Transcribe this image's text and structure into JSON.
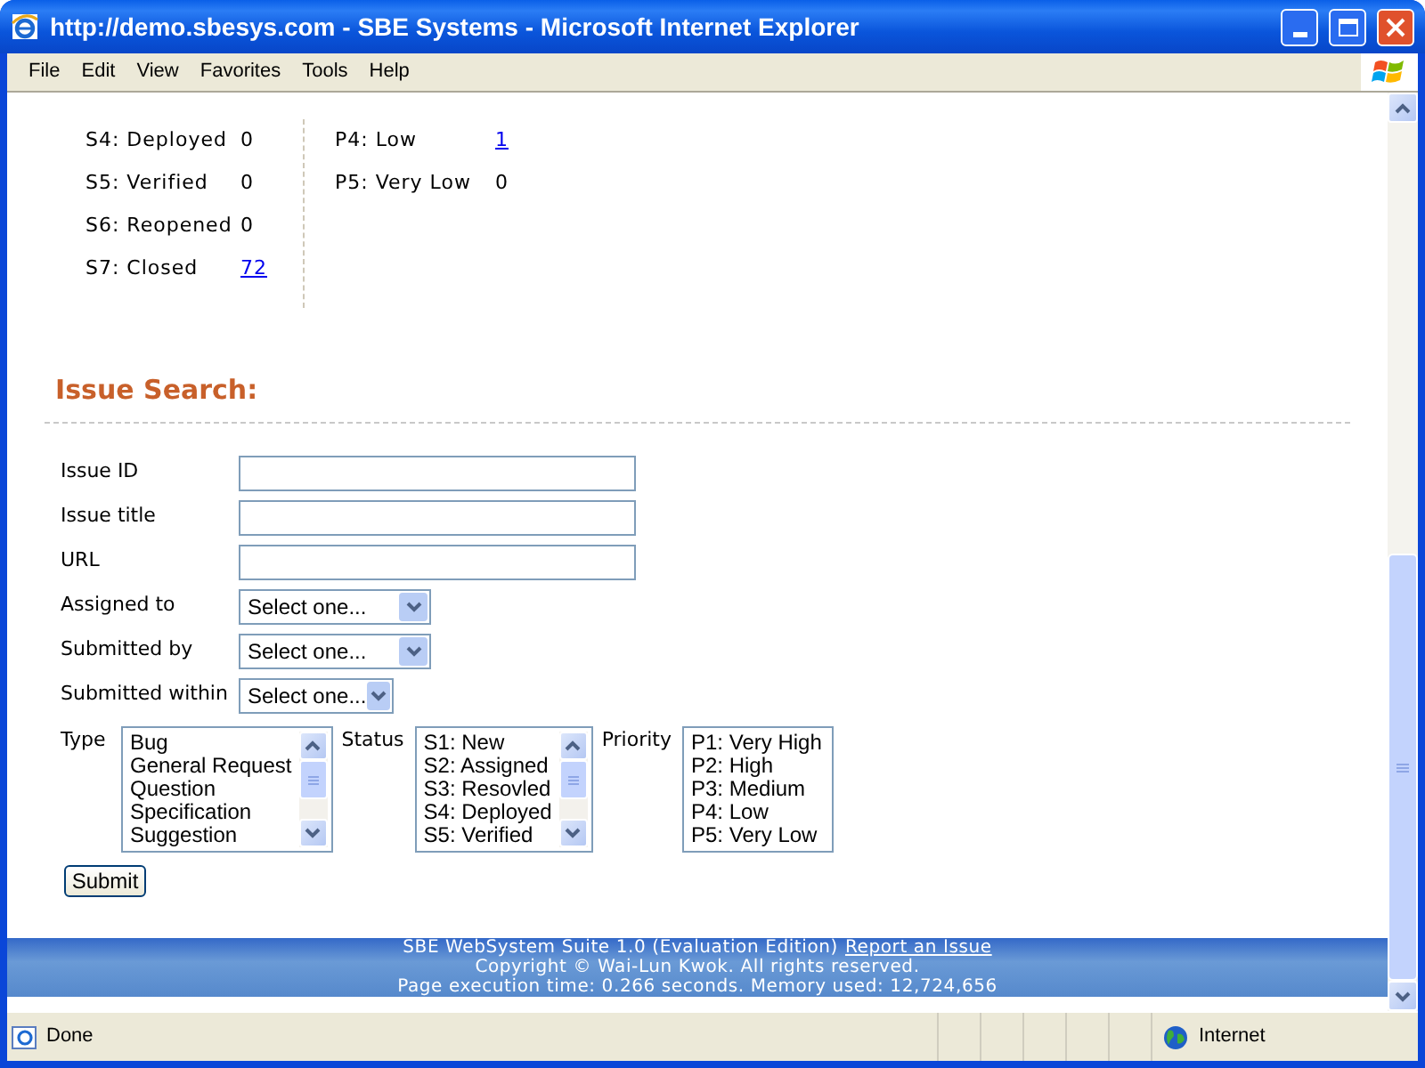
{
  "window": {
    "title": "http://demo.sbesys.com - SBE Systems - Microsoft Internet Explorer"
  },
  "menu": [
    "File",
    "Edit",
    "View",
    "Favorites",
    "Tools",
    "Help"
  ],
  "stats": {
    "status": [
      {
        "label": "S4: Deployed",
        "count": "0",
        "link": false
      },
      {
        "label": "S5: Verified",
        "count": "0",
        "link": false
      },
      {
        "label": "S6: Reopened",
        "count": "0",
        "link": false
      },
      {
        "label": "S7: Closed",
        "count": "72",
        "link": true
      }
    ],
    "priority": [
      {
        "label": "P4: Low",
        "count": "1",
        "link": true
      },
      {
        "label": "P5: Very Low",
        "count": "0",
        "link": false
      }
    ]
  },
  "search": {
    "title": "Issue Search:",
    "fields": [
      {
        "kind": "text",
        "label": "Issue ID"
      },
      {
        "kind": "text",
        "label": "Issue title"
      },
      {
        "kind": "text",
        "label": "URL"
      },
      {
        "kind": "select",
        "label": "Assigned to",
        "value": "Select one..."
      },
      {
        "kind": "select",
        "label": "Submitted by",
        "value": "Select one..."
      },
      {
        "kind": "select",
        "label": "Submitted within",
        "value": "Select one..."
      }
    ],
    "lists": [
      {
        "label": "Type",
        "scrollable": true,
        "options": [
          "Bug",
          "General Request",
          "Question",
          "Specification",
          "Suggestion"
        ]
      },
      {
        "label": "Status",
        "scrollable": true,
        "options": [
          "S1: New",
          "S2: Assigned",
          "S3: Resovled",
          "S4: Deployed",
          "S5: Verified"
        ]
      },
      {
        "label": "Priority",
        "scrollable": false,
        "options": [
          "P1: Very High",
          "P2: High",
          "P3: Medium",
          "P4: Low",
          "P5: Very Low"
        ]
      }
    ],
    "submit": "Submit"
  },
  "footer": {
    "line_1": "SBE WebSystem Suite 1.0 (Evaluation Edition)",
    "link": "Report an Issue",
    "line_2": "Copyright © Wai-Lun Kwok. All rights reserved.",
    "line_3": "Page execution time: 0.266 seconds. Memory used: 12,724,656"
  },
  "status_bar": {
    "text": "Done",
    "zone": "Internet"
  }
}
